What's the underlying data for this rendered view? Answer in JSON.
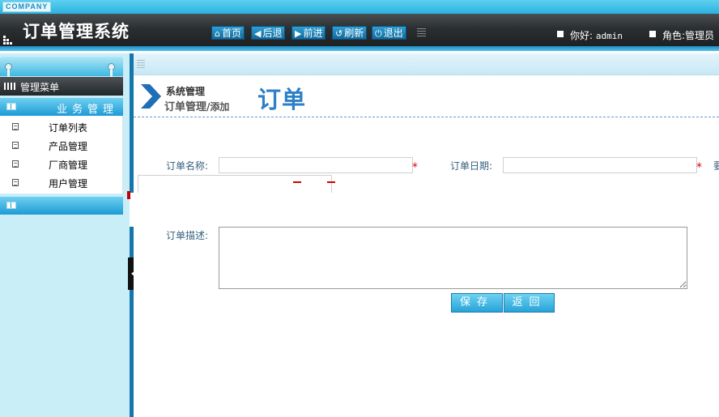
{
  "header": {
    "company": "COMPANY",
    "title": "订单管理系统",
    "toolbar": [
      {
        "label": "首页",
        "icon": "home-icon"
      },
      {
        "label": "后退",
        "icon": "arrow-left-icon"
      },
      {
        "label": "前进",
        "icon": "arrow-right-icon"
      },
      {
        "label": "刷新",
        "icon": "refresh-icon"
      },
      {
        "label": "退出",
        "icon": "power-icon"
      }
    ],
    "greeting_label": "你好:",
    "username": "admin",
    "role_label": "角色:",
    "role": "管理员"
  },
  "sidebar": {
    "menu_title": "管理菜单",
    "section_title": "业务管理",
    "items": [
      {
        "label": "订单列表"
      },
      {
        "label": "产品管理"
      },
      {
        "label": "厂商管理"
      },
      {
        "label": "用户管理"
      }
    ]
  },
  "breadcrumb": {
    "top": "系统管理",
    "path": "订单管理",
    "action": "/添加"
  },
  "page_title": "订单",
  "form": {
    "name_label": "订单名称:",
    "name_value": "",
    "date_label": "订单日期:",
    "date_value": "",
    "required_mark": "*",
    "desc_label": "订单描述:",
    "desc_value": "",
    "save_label": "保存",
    "back_label": "返回",
    "extra_label": "要"
  },
  "colors": {
    "accent": "#2d7fc7",
    "header_dark": "#2b2f31",
    "sidebar_bg": "#caeef8",
    "required": "#e00000"
  }
}
